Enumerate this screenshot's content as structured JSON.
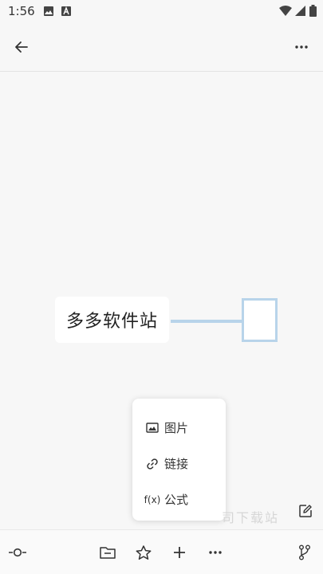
{
  "status_bar": {
    "time": "1:56",
    "icons": [
      "image-icon",
      "a-badge-icon",
      "wifi-icon",
      "signal-icon",
      "battery-icon"
    ]
  },
  "top_bar": {
    "back_icon": "arrow-left-icon",
    "more_icon": "more-horizontal-icon"
  },
  "mindmap": {
    "root_text": "多多软件站",
    "connector_color": "#b8d4ea",
    "child_text": ""
  },
  "insert_menu": {
    "items": [
      {
        "icon": "image-icon",
        "label": "图片"
      },
      {
        "icon": "link-icon",
        "label": "链接"
      },
      {
        "icon": "formula-icon",
        "label": "公式",
        "icon_text": "f(x)"
      }
    ]
  },
  "watermark": "司下载站",
  "bottom_bar": {
    "items": [
      "node-toggle-icon",
      "folder-icon",
      "star-icon",
      "plus-icon",
      "more-horizontal-icon",
      "branch-icon"
    ]
  },
  "colors": {
    "background": "#f7f7f7",
    "accent": "#b8d4ea"
  }
}
